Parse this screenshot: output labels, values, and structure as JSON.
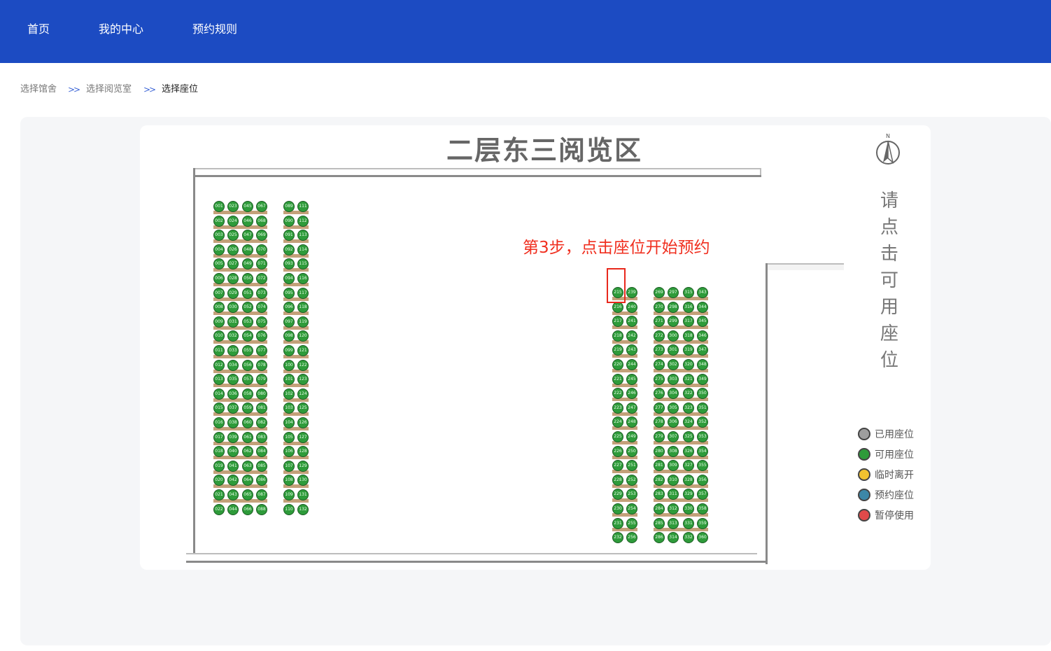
{
  "nav": {
    "items": [
      {
        "label": "首页"
      },
      {
        "label": "我的中心"
      },
      {
        "label": "预约规则"
      }
    ]
  },
  "breadcrumb": {
    "items": [
      "选择馆舍",
      "选择阅览室",
      "选择座位"
    ],
    "separator": ">>"
  },
  "hall": {
    "title": "二层东三阅览区"
  },
  "compass": {
    "letter": "N"
  },
  "hint": {
    "text": "第3步，点击座位开始预约"
  },
  "side_instruction": [
    "请",
    "点",
    "击",
    "可",
    "用",
    "座",
    "位"
  ],
  "legend": [
    {
      "label": "已用座位",
      "color": "#9e9e9e"
    },
    {
      "label": "可用座位",
      "color": "#2e9b3a"
    },
    {
      "label": "临时离开",
      "color": "#f2c230"
    },
    {
      "label": "预约座位",
      "color": "#3c87a8"
    },
    {
      "label": "暂停使用",
      "color": "#e04a4a"
    }
  ],
  "seat_status_color": {
    "available": "#2e9b3a"
  },
  "seat_blocks": [
    {
      "columns": [
        [
          "001",
          "002",
          "003",
          "004",
          "005",
          "006",
          "007",
          "008",
          "009",
          "010",
          "011",
          "012",
          "013",
          "014",
          "015",
          "016",
          "017",
          "018",
          "019",
          "020",
          "021",
          "022"
        ],
        [
          "023",
          "024",
          "025",
          "026",
          "027",
          "028",
          "029",
          "030",
          "031",
          "032",
          "033",
          "034",
          "035",
          "036",
          "037",
          "038",
          "039",
          "040",
          "041",
          "042",
          "043",
          "044"
        ],
        [
          "045",
          "046",
          "047",
          "048",
          "049",
          "050",
          "051",
          "052",
          "053",
          "054",
          "055",
          "056",
          "057",
          "058",
          "059",
          "060",
          "061",
          "062",
          "063",
          "064",
          "065",
          "066"
        ],
        [
          "067",
          "068",
          "069",
          "070",
          "071",
          "072",
          "073",
          "074",
          "075",
          "076",
          "077",
          "078",
          "079",
          "080",
          "081",
          "082",
          "083",
          "084",
          "085",
          "086",
          "087",
          "088"
        ]
      ]
    },
    {
      "columns": [
        [
          "089",
          "090",
          "091",
          "092",
          "093",
          "094",
          "095",
          "096",
          "097",
          "098",
          "099",
          "100",
          "101",
          "102",
          "103",
          "104",
          "105",
          "106",
          "107",
          "108",
          "109",
          "110"
        ],
        [
          "111",
          "112",
          "113",
          "114",
          "115",
          "116",
          "117",
          "118",
          "119",
          "120",
          "121",
          "122",
          "123",
          "124",
          "125",
          "126",
          "127",
          "128",
          "129",
          "130",
          "131",
          "132"
        ]
      ]
    },
    {
      "columns": [
        [
          "215",
          "216",
          "217",
          "218",
          "219",
          "220",
          "221",
          "222",
          "223",
          "224",
          "225",
          "226",
          "227",
          "228",
          "229",
          "230",
          "231",
          "232"
        ],
        [
          "239",
          "240",
          "241",
          "242",
          "243",
          "244",
          "245",
          "246",
          "247",
          "248",
          "249",
          "250",
          "251",
          "252",
          "253",
          "254",
          "255",
          "256"
        ]
      ]
    },
    {
      "columns": [
        [
          "269",
          "270",
          "271",
          "272",
          "273",
          "274",
          "275",
          "276",
          "277",
          "278",
          "279",
          "280",
          "281",
          "282",
          "283",
          "284",
          "285",
          "286"
        ],
        [
          "297",
          "298",
          "299",
          "300",
          "301",
          "302",
          "303",
          "304",
          "305",
          "306",
          "307",
          "308",
          "309",
          "310",
          "311",
          "312",
          "313",
          "314"
        ],
        [
          "315",
          "316",
          "317",
          "318",
          "319",
          "320",
          "321",
          "322",
          "323",
          "324",
          "325",
          "326",
          "327",
          "328",
          "329",
          "330",
          "331",
          "332"
        ],
        [
          "343",
          "344",
          "345",
          "346",
          "347",
          "348",
          "349",
          "350",
          "351",
          "352",
          "353",
          "354",
          "355",
          "356",
          "357",
          "358",
          "359",
          "360"
        ]
      ]
    }
  ]
}
